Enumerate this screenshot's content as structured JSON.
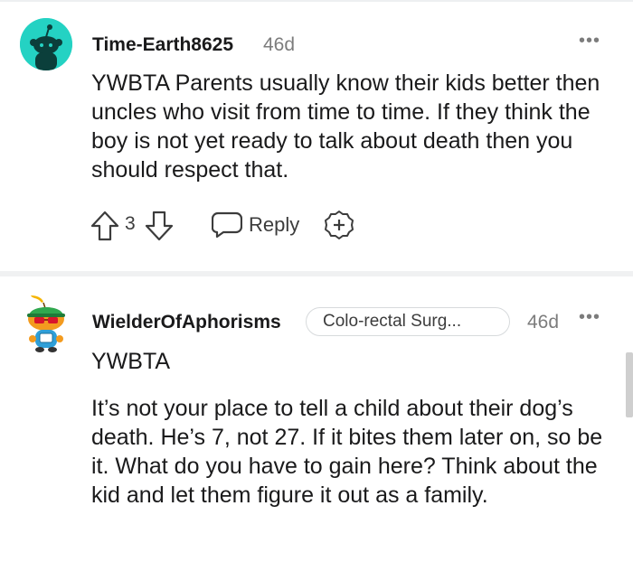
{
  "comments": [
    {
      "username": "Time-Earth8625",
      "age": "46d",
      "more": "•••",
      "body": "YWBTA Parents usually know their kids better then uncles who visit from time to time. If they think the boy is not yet ready to talk about death then you should respect that.",
      "votes": "3",
      "reply_label": "Reply",
      "avatar_icon": "snoo-avatar-icon",
      "avatar_color": "#24d2c3"
    },
    {
      "username": "WielderOfAphorisms",
      "flair": "Colo-rectal Surg...",
      "age": "46d",
      "more": "•••",
      "body_line1": "YWBTA",
      "body_paragraph": "It’s not your place to tell a child about their dog’s death. He’s 7, not 27. If it bites them later on, so be it. What do you have to gain here? Think about the kid and let them figure it out as a family.",
      "avatar_icon": "snoo-avatar-icon"
    }
  ],
  "icons": [
    "upvote-icon",
    "downvote-icon",
    "reply-icon",
    "award-icon",
    "more-options-icon"
  ]
}
